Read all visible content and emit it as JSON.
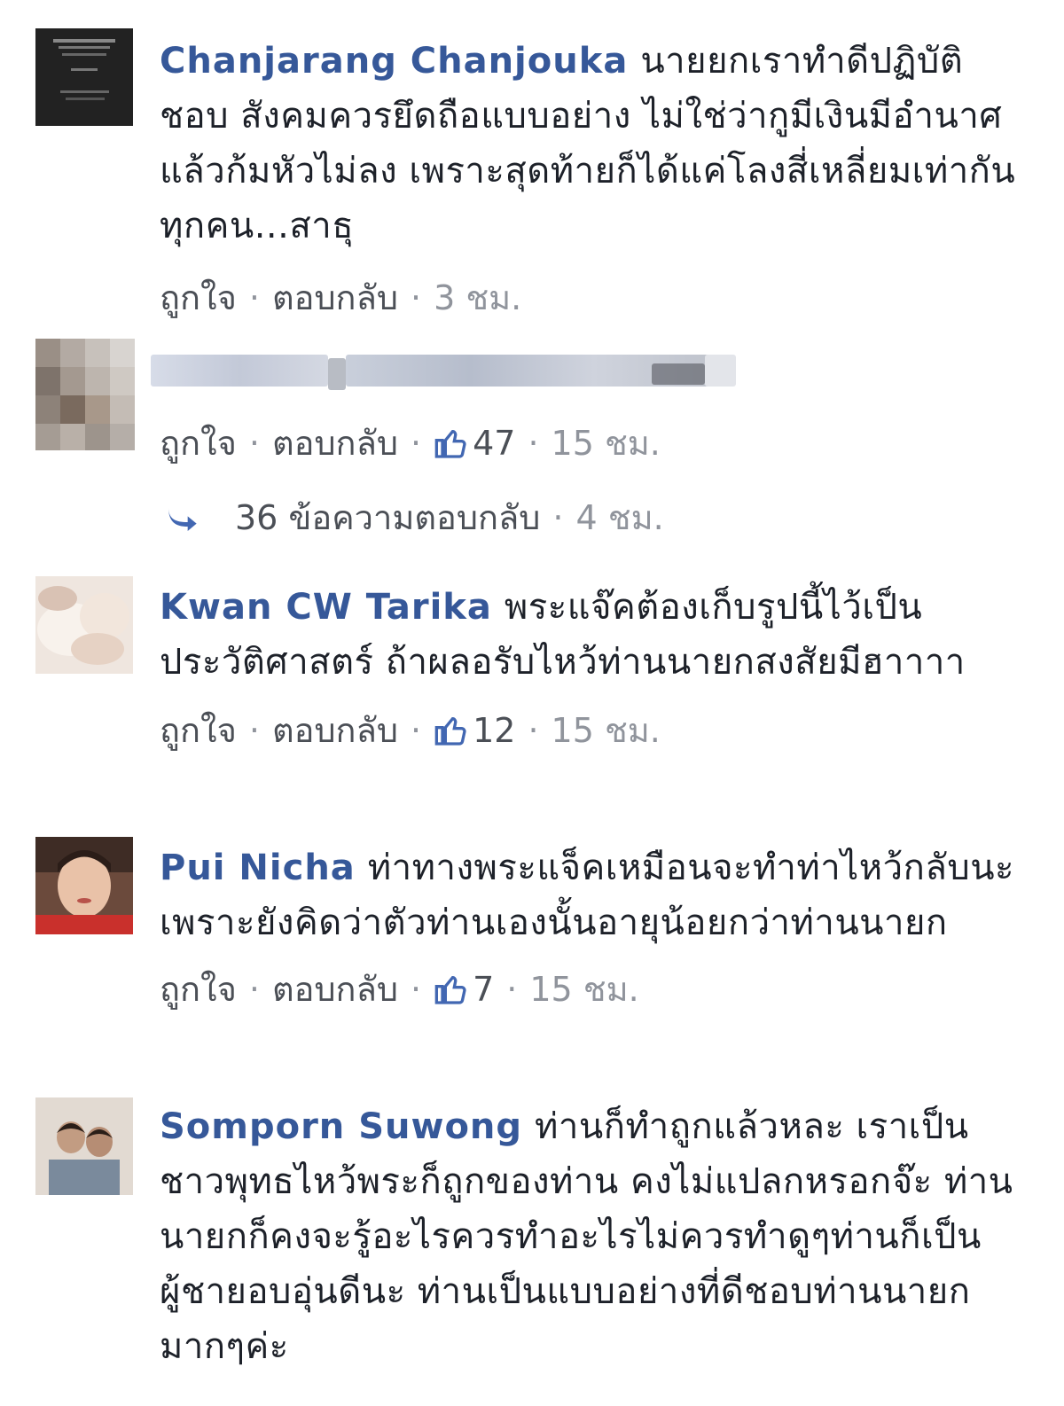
{
  "comments": [
    {
      "author": "Chanjarang Chanjouka",
      "text": "นายยกเราทำดีปฏิบัติชอบ สังคมควรยึดถือแบบอย่าง ไม่ใช่ว่ากูมีเงินมีอำนาศแล้วก้มหัวไม่ลง เพราะสุดท้ายก็ได้แค่โลงสี่เหลี่ยมเท่ากันทุกคน...สาธุ",
      "like_label": "ถูกใจ",
      "reply_label": "ตอบกลับ",
      "likes": "",
      "time": "3 ชม."
    },
    {
      "author": "",
      "text": "",
      "like_label": "ถูกใจ",
      "reply_label": "ตอบกลับ",
      "likes": "47",
      "time": "15 ชม.",
      "replies_label": "36 ข้อความตอบกลับ",
      "replies_time": "4 ชม."
    },
    {
      "author": "Kwan CW Tarika",
      "text": "พระแจ๊คต้องเก็บรูปนี้ไว้เป็นประวัติศาสตร์ ถ้าผลอรับไหว้ท่านนายกสงสัยมีฮาาาา",
      "like_label": "ถูกใจ",
      "reply_label": "ตอบกลับ",
      "likes": "12",
      "time": "15 ชม."
    },
    {
      "author": "Pui Nicha",
      "text": "ท่าทางพระแจ็คเหมือนจะทำท่าไหว้กลับนะเพราะยังคิดว่าตัวท่านเองนั้นอายุน้อยกว่าท่านนายก",
      "like_label": "ถูกใจ",
      "reply_label": "ตอบกลับ",
      "likes": "7",
      "time": "15 ชม."
    },
    {
      "author": "Somporn Suwong",
      "text": "ท่านก็ทำถูกแล้วหละ เราเป็นชาวพุทธไหว้พระก็ถูกของท่าน คงไม่แปลกหรอกจ๊ะ ท่านนายกก็คงจะรู้อะไรควรทำอะไรไม่ควรทำดูๆท่านก็เป็นผู้ชายอบอุ่นดีนะ ท่านเป็นแบบอย่างที่ดีชอบท่านนายกมากๆค่ะ",
      "like_label": "",
      "reply_label": "",
      "likes": "",
      "time": ""
    }
  ],
  "colors": {
    "author": "#365899",
    "text": "#1d2129",
    "meta": "#90949c",
    "link": "#4b4f56",
    "like_icon": "#4267b2"
  },
  "icons": {
    "like": "thumbs-up-icon",
    "reply_arrow": "reply-arrow-icon"
  }
}
